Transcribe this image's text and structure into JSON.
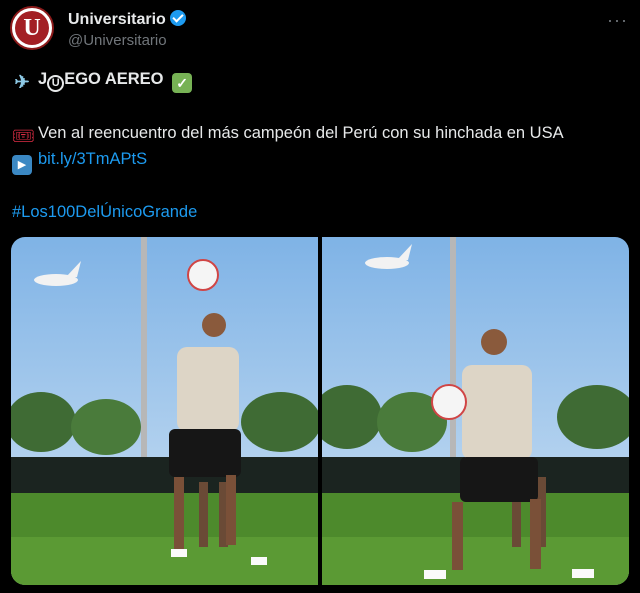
{
  "account": {
    "display_name": "Universitario",
    "handle": "@Universitario",
    "avatar_letter": "U",
    "verified": true
  },
  "tweet": {
    "title_pre": "J",
    "title_u": "U",
    "title_post": "EGO AEREO",
    "body": "Ven al reencuentro del más campeón del Perú con su hinchada en USA",
    "link": "bit.ly/3TmAPtS",
    "hashtag": "#Los100DelÚnicoGrande"
  },
  "icons": [
    "more-icon",
    "verified-icon",
    "airplane-icon",
    "check-icon",
    "ticket-icon",
    "play-icon"
  ],
  "colors": {
    "link": "#1d9bf0",
    "background": "#000000",
    "text": "#e7e9ea",
    "muted": "#71767b",
    "brand": "#a31f24"
  },
  "media": [
    "photo-player-heading-ball",
    "photo-player-chest-ball"
  ]
}
